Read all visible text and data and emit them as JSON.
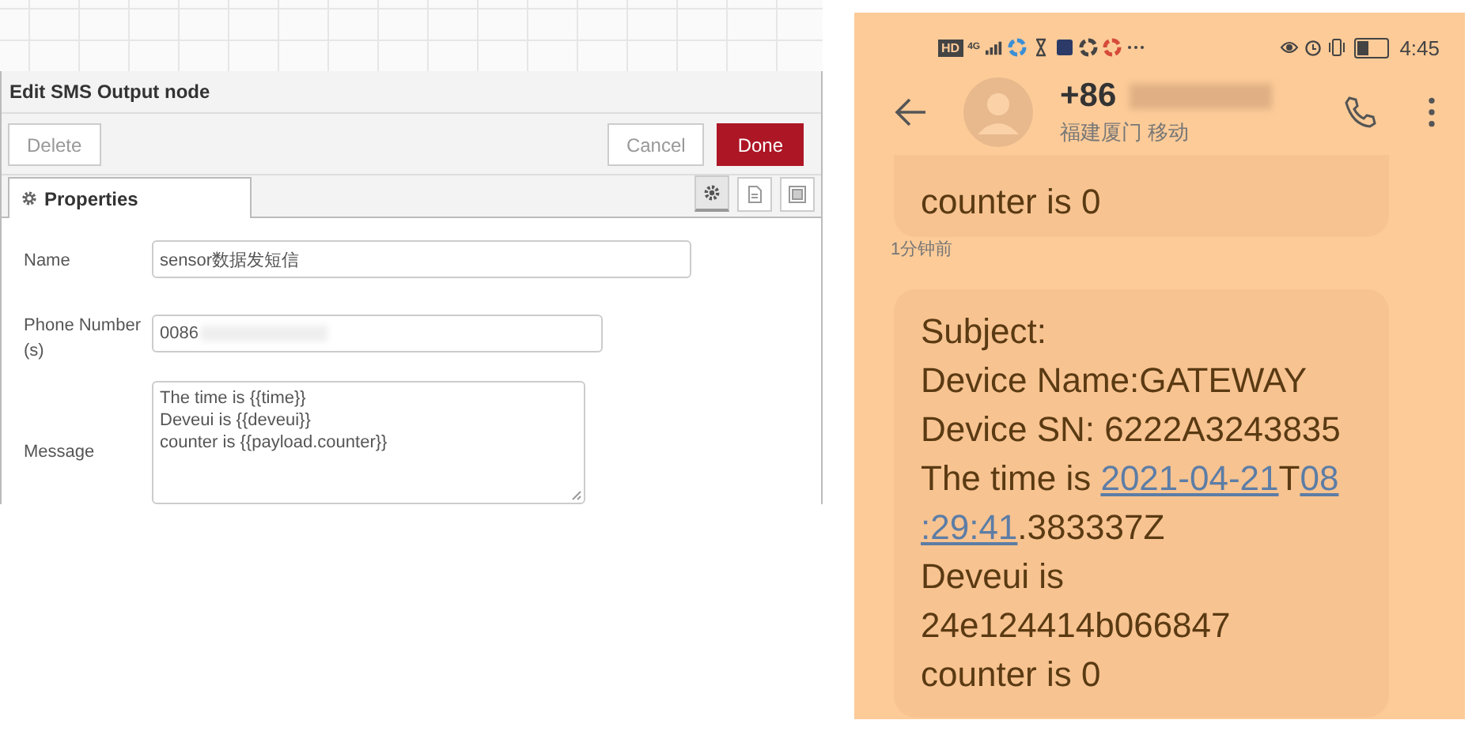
{
  "editor": {
    "title": "Edit SMS Output node",
    "buttons": [
      {
        "label": "Delete",
        "kind": "plain"
      },
      {
        "label": "Cancel",
        "kind": "plain"
      },
      {
        "label": "Done",
        "kind": "primary"
      }
    ],
    "tabs": [
      {
        "label": "Properties",
        "selected": true
      }
    ],
    "icon_tabs": [
      {
        "selected": true
      },
      {
        "selected": false
      },
      {
        "selected": false
      }
    ],
    "fields": [
      {
        "label": "Name",
        "kind": "text",
        "value": "sensor数据发短信"
      },
      {
        "label": "Phone Number (s)",
        "kind": "text",
        "value": "0086",
        "blurred": true
      },
      {
        "label": "Message",
        "kind": "textarea",
        "value": "The time is {{time}}\nDeveui is {{deveui}}\ncounter is {{payload.counter}}"
      }
    ]
  },
  "phone": {
    "status_bar": {
      "badge": "HD",
      "network": "4G",
      "time": "4:45"
    },
    "contact": {
      "number": "+86",
      "blurred": true,
      "location": "福建厦门 移动"
    },
    "messages": [
      {
        "kind": "message",
        "lines": [
          [
            {
              "text": "counter is 0",
              "link": false
            }
          ]
        ]
      },
      {
        "kind": "timestamp",
        "text": "1分钟前"
      },
      {
        "kind": "message",
        "lines": [
          [
            {
              "text": "Subject:",
              "link": false
            }
          ],
          [
            {
              "text": "Device Name:GATEWAY",
              "link": false
            }
          ],
          [
            {
              "text": "Device SN: 6222A3243835",
              "link": false
            }
          ],
          [
            {
              "text": "The time is ",
              "link": false
            },
            {
              "text": "2021-04-21",
              "link": true
            },
            {
              "text": "T",
              "link": false
            },
            {
              "text": "08",
              "link": true
            }
          ],
          [
            {
              "text": ":29:41",
              "link": true
            },
            {
              "text": ".383337Z",
              "link": false
            }
          ],
          [
            {
              "text": "Deveui is",
              "link": false
            }
          ],
          [
            {
              "text": "24e124414b066847",
              "link": false
            }
          ],
          [
            {
              "text": "counter is 0",
              "link": false
            }
          ]
        ]
      }
    ]
  }
}
